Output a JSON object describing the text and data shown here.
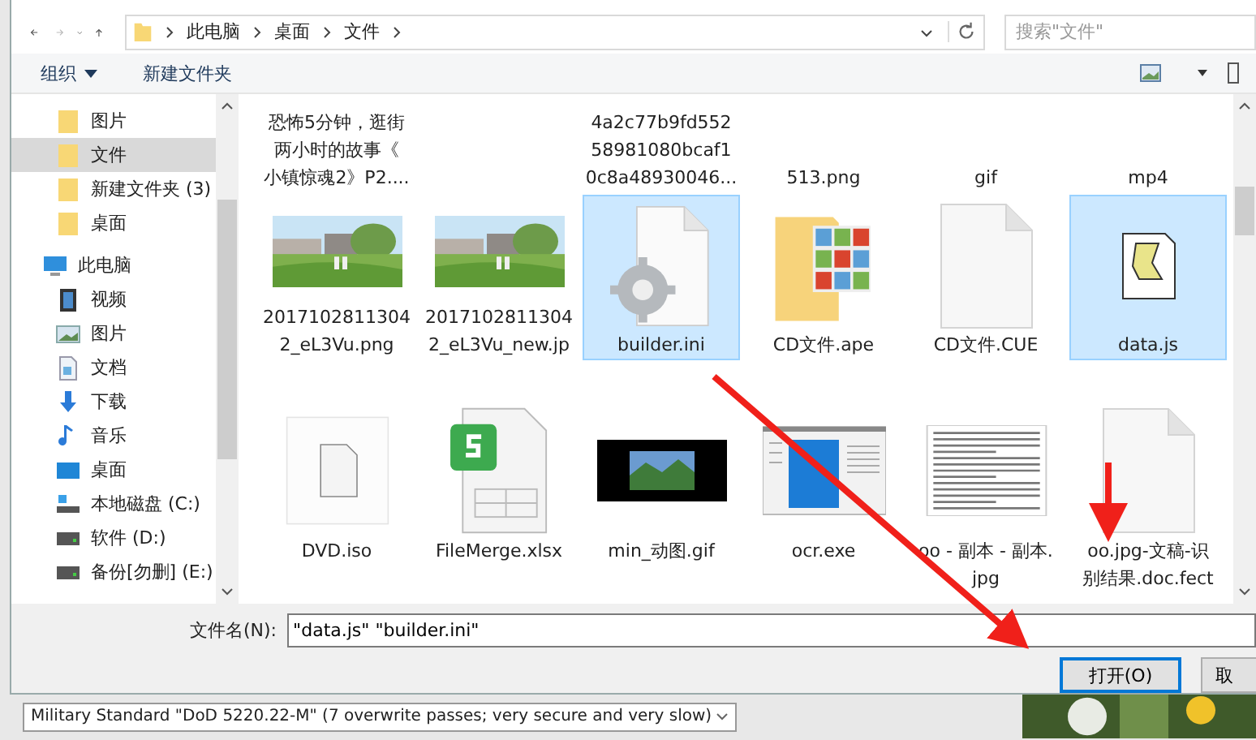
{
  "address_bar": {
    "path": [
      "此电脑",
      "桌面",
      "文件"
    ]
  },
  "search": {
    "placeholder": "搜索\"文件\""
  },
  "toolbar": {
    "organize": "组织",
    "new_folder": "新建文件夹"
  },
  "nav": {
    "items": [
      {
        "label": "图片",
        "kind": "folder",
        "selected": false
      },
      {
        "label": "文件",
        "kind": "folder",
        "selected": true
      },
      {
        "label": "新建文件夹 (3)",
        "kind": "folder",
        "selected": false
      },
      {
        "label": "桌面",
        "kind": "folder",
        "selected": false
      },
      {
        "label": "此电脑",
        "kind": "pc",
        "selected": false,
        "children": [
          {
            "label": "视频",
            "kind": "video",
            "selected": false
          },
          {
            "label": "图片",
            "kind": "picture",
            "selected": false
          },
          {
            "label": "文档",
            "kind": "doc",
            "selected": false
          },
          {
            "label": "下载",
            "kind": "download",
            "selected": false
          },
          {
            "label": "音乐",
            "kind": "music",
            "selected": false
          },
          {
            "label": "桌面",
            "kind": "desktop",
            "selected": false
          },
          {
            "label": "本地磁盘 (C:)",
            "kind": "system-drive",
            "selected": false
          },
          {
            "label": "软件 (D:)",
            "kind": "drive",
            "selected": false
          },
          {
            "label": "备份[勿删] (E:)",
            "kind": "drive",
            "selected": false
          }
        ]
      }
    ]
  },
  "top_row_names": [
    {
      "lines": [
        "恐怖5分钟，逛街",
        "两小时的故事《",
        "小镇惊魂2》P2...."
      ]
    },
    {
      "lines": [
        "4a2c77b9fd552",
        "58981080bcaf1",
        "0c8a48930046..."
      ]
    },
    {
      "lines": [
        "513.png"
      ]
    },
    {
      "lines": [
        "gif"
      ]
    },
    {
      "lines": [
        "mp4"
      ]
    }
  ],
  "files": [
    {
      "selected": false,
      "lines": [
        "2017102811304",
        "2_eL3Vu.png"
      ]
    },
    {
      "selected": false,
      "lines": [
        "2017102811304",
        "2_eL3Vu_new.jp"
      ]
    },
    {
      "kind": "settings-file",
      "selected": true,
      "lines": [
        "builder.ini"
      ]
    },
    {
      "kind": "image-folder",
      "selected": false,
      "lines": [
        "CD文件.ape"
      ]
    },
    {
      "kind": "blank-file",
      "selected": false,
      "lines": [
        "CD文件.CUE"
      ]
    },
    {
      "kind": "script-file",
      "selected": true,
      "lines": [
        "data.js"
      ]
    },
    {
      "kind": "disc-file",
      "selected": false,
      "lines": [
        "DVD.iso"
      ]
    },
    {
      "kind": "spreadsheet",
      "selected": false,
      "lines": [
        "FileMerge.xlsx"
      ]
    },
    {
      "kind": "animation",
      "selected": false,
      "lines": [
        "min_动图.gif"
      ]
    },
    {
      "kind": "app-window",
      "selected": false,
      "lines": [
        "ocr.exe"
      ]
    },
    {
      "kind": "text-image",
      "selected": false,
      "lines": [
        "oo - 副本 - 副本.",
        "jpg"
      ]
    },
    {
      "kind": "blank-file",
      "selected": false,
      "lines": [
        "oo.jpg-文稿-识",
        "别结果.doc.fect"
      ]
    }
  ],
  "filename": {
    "label": "文件名(N):",
    "value": "\"data.js\" \"builder.ini\""
  },
  "buttons": [
    {
      "label": "打开(O)",
      "default": true
    },
    {
      "label": "取",
      "default": false
    }
  ],
  "background": {
    "dropdown": "Military Standard \"DoD 5220.22-M\" (7 overwrite passes; very secure and very slow)"
  }
}
